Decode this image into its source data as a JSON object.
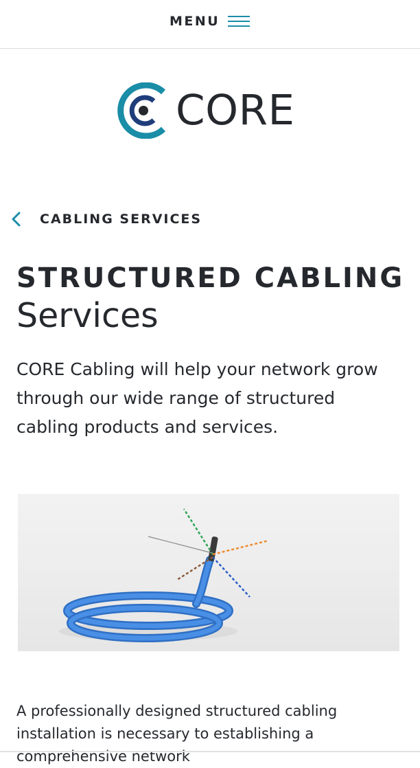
{
  "header": {
    "menu_label": "MENU",
    "menu_icon": "hamburger-icon",
    "accent_color": "#1a8da7"
  },
  "logo": {
    "text": "CORE",
    "icon": "core-logo-icon",
    "outer_ring_color": "#1a8da7",
    "inner_color": "#1f3d7a"
  },
  "breadcrumb": {
    "label": "CABLING SERVICES",
    "icon": "chevron-left-icon"
  },
  "page": {
    "title": "STRUCTURED CABLING",
    "subtitle": "Services",
    "intro": "CORE Cabling will help your network grow through our wide range of structured cabling products and services.",
    "body": "A professionally designed structured cabling installation is necessary to establishing a comprehensive network"
  },
  "hero": {
    "icon": "blue-ethernet-cable-photo",
    "cable_color": "#3c7fd6"
  }
}
